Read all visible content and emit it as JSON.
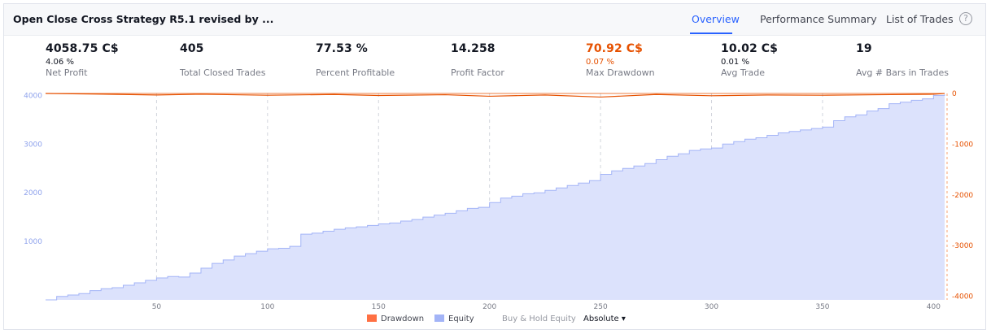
{
  "header": {
    "title": "Open Close Cross Strategy R5.1 revised by ...",
    "tabs": [
      {
        "label": "Overview",
        "active": true
      },
      {
        "label": "Performance Summary",
        "active": false
      },
      {
        "label": "List of Trades",
        "active": false
      }
    ],
    "help_label": "?"
  },
  "stats": [
    {
      "value": "4058.75 C$",
      "sub": "4.06 %",
      "label": "Net Profit"
    },
    {
      "value": "405",
      "sub": "",
      "label": "Total Closed Trades"
    },
    {
      "value": "77.53 %",
      "sub": "",
      "label": "Percent Profitable"
    },
    {
      "value": "14.258",
      "sub": "",
      "label": "Profit Factor"
    },
    {
      "value": "70.92 C$",
      "sub": "0.07 %",
      "label": "Max Drawdown",
      "negative": true
    },
    {
      "value": "10.02 C$",
      "sub": "0.01 %",
      "label": "Avg Trade"
    },
    {
      "value": "19",
      "sub": "",
      "label": "Avg # Bars in Trades"
    }
  ],
  "legend": {
    "drawdown": "Drawdown",
    "equity": "Equity",
    "buy_hold": "Buy & Hold Equity",
    "mode": "Absolute",
    "mode_caret": "▾"
  },
  "colors": {
    "accent": "#2962ff",
    "drawdown": "#e65100",
    "drawdown_swatch": "#ff7043",
    "equity_line": "#a3b4f7",
    "equity_fill": "#dce2fc"
  },
  "chart_data": {
    "type": "area",
    "x_ticks": [
      50,
      100,
      150,
      200,
      250,
      300,
      350,
      400
    ],
    "xlim": [
      0,
      405
    ],
    "left_axis": {
      "ticks": [
        1000,
        2000,
        3000,
        4000
      ],
      "ylim": [
        -200,
        4040
      ]
    },
    "right_axis": {
      "ticks": [
        0,
        -1000,
        -2000,
        -3000,
        -4000
      ],
      "ylim": [
        -4070,
        0
      ]
    },
    "series": [
      {
        "name": "Equity",
        "axis": "left",
        "x": [
          0,
          5,
          10,
          15,
          20,
          25,
          30,
          35,
          40,
          45,
          50,
          55,
          60,
          65,
          70,
          75,
          80,
          85,
          90,
          95,
          100,
          105,
          110,
          115,
          120,
          125,
          130,
          135,
          140,
          145,
          150,
          155,
          160,
          165,
          170,
          175,
          180,
          185,
          190,
          195,
          200,
          205,
          210,
          215,
          220,
          225,
          230,
          235,
          240,
          245,
          250,
          255,
          260,
          265,
          270,
          275,
          280,
          285,
          290,
          295,
          300,
          305,
          310,
          315,
          320,
          325,
          330,
          335,
          340,
          345,
          350,
          355,
          360,
          365,
          370,
          375,
          380,
          385,
          390,
          395,
          400,
          405
        ],
        "values": [
          -200,
          -130,
          -100,
          -70,
          -10,
          30,
          50,
          100,
          150,
          200,
          250,
          280,
          270,
          350,
          450,
          550,
          620,
          700,
          750,
          800,
          850,
          860,
          900,
          1150,
          1170,
          1210,
          1250,
          1280,
          1300,
          1330,
          1360,
          1380,
          1420,
          1450,
          1500,
          1540,
          1580,
          1630,
          1680,
          1700,
          1800,
          1890,
          1930,
          1980,
          2000,
          2050,
          2100,
          2150,
          2200,
          2250,
          2380,
          2450,
          2500,
          2550,
          2600,
          2680,
          2750,
          2800,
          2870,
          2900,
          2920,
          3000,
          3050,
          3100,
          3130,
          3180,
          3230,
          3260,
          3290,
          3320,
          3350,
          3480,
          3560,
          3600,
          3680,
          3730,
          3830,
          3860,
          3900,
          3930,
          4000,
          4020
        ]
      },
      {
        "name": "Drawdown",
        "axis": "right",
        "x": [
          0,
          20,
          50,
          70,
          100,
          130,
          150,
          180,
          200,
          225,
          250,
          275,
          300,
          325,
          350,
          375,
          400,
          405
        ],
        "values": [
          0,
          -10,
          -30,
          -15,
          -35,
          -20,
          -40,
          -25,
          -55,
          -30,
          -71,
          -20,
          -45,
          -30,
          -35,
          -25,
          -15,
          0
        ]
      }
    ]
  }
}
